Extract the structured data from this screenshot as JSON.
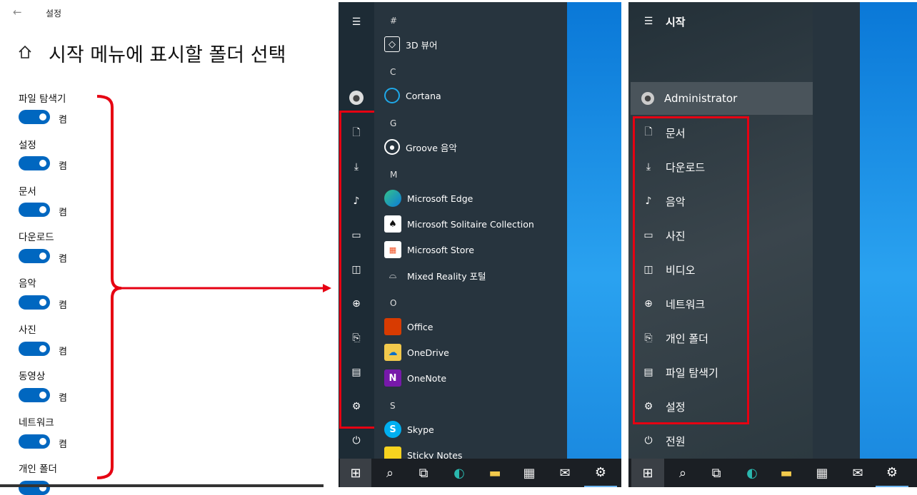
{
  "settings": {
    "back_icon": "←",
    "app_title": "설정",
    "heading": "시작 메뉴에 표시할 폴더 선택",
    "toggles": [
      {
        "label": "파일 탐색기",
        "state": "켬"
      },
      {
        "label": "설정",
        "state": "켬"
      },
      {
        "label": "문서",
        "state": "켬"
      },
      {
        "label": "다운로드",
        "state": "켬"
      },
      {
        "label": "음악",
        "state": "켬"
      },
      {
        "label": "사진",
        "state": "켬"
      },
      {
        "label": "동영상",
        "state": "켬"
      },
      {
        "label": "네트워크",
        "state": "켬"
      },
      {
        "label": "개인 폴더",
        "state": ""
      }
    ]
  },
  "start_compact": {
    "letters": [
      "#",
      "C",
      "G",
      "M",
      "O",
      "S"
    ],
    "apps": [
      {
        "name": "3D 뷰어",
        "icon": "cube-icon"
      },
      {
        "name": "Cortana",
        "icon": "cortana-icon"
      },
      {
        "name": "Groove 음악",
        "icon": "groove-icon"
      },
      {
        "name": "Microsoft Edge",
        "icon": "edge-icon"
      },
      {
        "name": "Microsoft Solitaire Collection",
        "icon": "cards-icon"
      },
      {
        "name": "Microsoft Store",
        "icon": "store-icon"
      },
      {
        "name": "Mixed Reality 포털",
        "icon": "headset-icon"
      },
      {
        "name": "Office",
        "icon": "office-icon"
      },
      {
        "name": "OneDrive",
        "icon": "onedrive-icon"
      },
      {
        "name": "OneNote",
        "icon": "onenote-icon"
      },
      {
        "name": "Skype",
        "icon": "skype-icon"
      },
      {
        "name": "Sticky Notes",
        "icon": "sticky-notes-icon"
      }
    ]
  },
  "start_expanded": {
    "title": "시작",
    "user": "Administrator",
    "items": [
      "문서",
      "다운로드",
      "음악",
      "사진",
      "비디오",
      "네트워크",
      "개인 폴더",
      "파일 탐색기",
      "설정"
    ],
    "power": "전원"
  },
  "colors": {
    "toggle_on": "#0067c0",
    "annotation_red": "#e60012",
    "desktop_blue": "#0a78d7"
  }
}
